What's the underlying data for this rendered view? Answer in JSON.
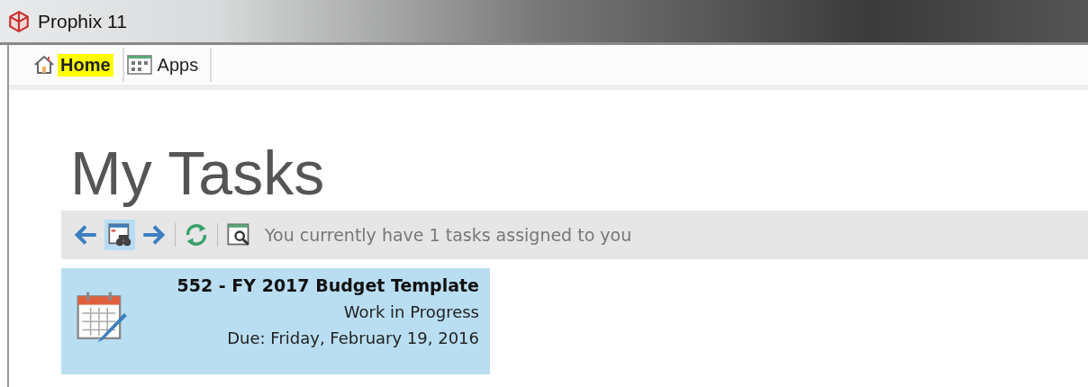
{
  "window": {
    "title": "Prophix 11"
  },
  "tabs": [
    {
      "label": "Home",
      "kind": "home",
      "selected": true
    },
    {
      "label": "Apps",
      "kind": "apps",
      "selected": false
    }
  ],
  "page_title": "My Tasks",
  "toolbar": {
    "buttons": [
      {
        "kind": "back",
        "selected": false
      },
      {
        "kind": "filter",
        "selected": true
      },
      {
        "kind": "forward",
        "selected": false
      },
      {
        "kind": "refresh",
        "selected": false
      },
      {
        "kind": "preview",
        "selected": false
      }
    ],
    "message": "You currently have 1 tasks assigned to you"
  },
  "tasks": [
    {
      "title": "552 - FY 2017 Budget Template",
      "status": "Work in Progress",
      "due": "Due: Friday, February 19, 2016",
      "selected": true
    }
  ]
}
